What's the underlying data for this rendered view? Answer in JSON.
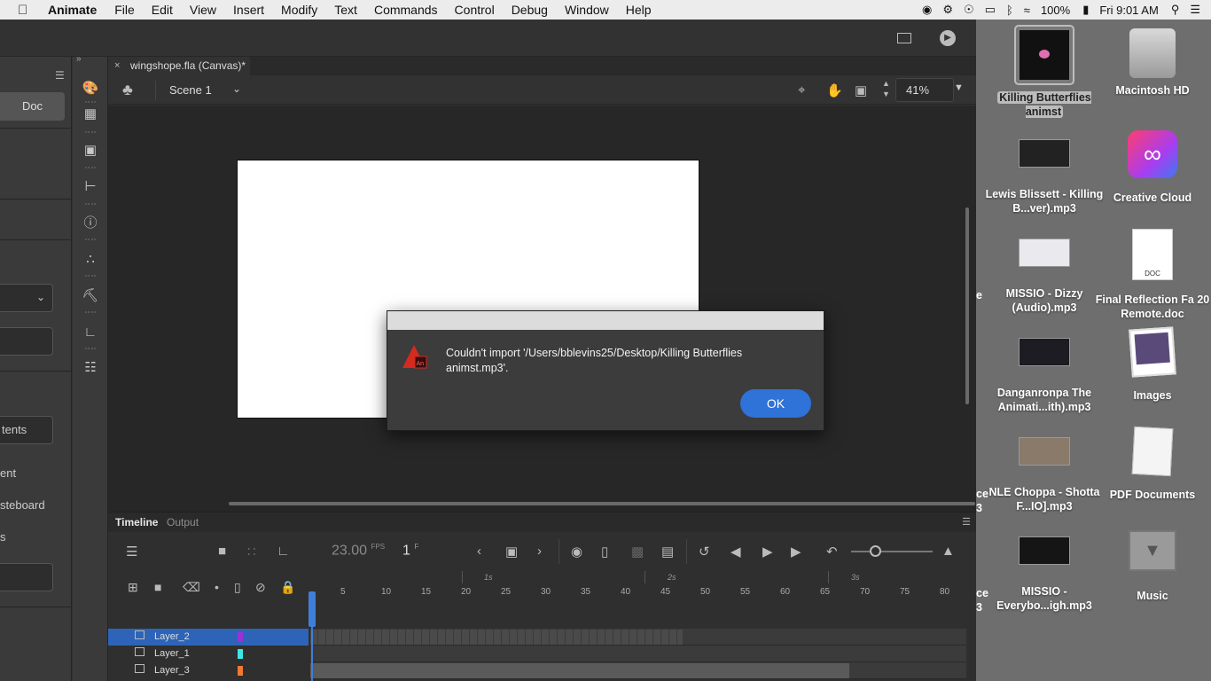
{
  "menubar": {
    "apple": "",
    "app_name": "Animate",
    "items": [
      "File",
      "Edit",
      "View",
      "Insert",
      "Modify",
      "Text",
      "Commands",
      "Control",
      "Debug",
      "Window",
      "Help"
    ],
    "battery": "100%",
    "clock": "Fri 9:01 AM"
  },
  "document": {
    "tab_title": "wingshope.fla (Canvas)*",
    "tab_close": "×",
    "scene": "Scene 1",
    "zoom": "41%"
  },
  "left_panel": {
    "doc_button": "Doc",
    "item_contents": "tents",
    "item_a": "ent",
    "item_b": "steboard",
    "item_c": "s"
  },
  "timeline": {
    "tab_timeline": "Timeline",
    "tab_output": "Output",
    "fps": "23.00",
    "fps_unit": "FPS",
    "frame": "1",
    "frame_unit": "F",
    "ruler_numbers": [
      "5",
      "10",
      "15",
      "20",
      "25",
      "30",
      "35",
      "40",
      "45",
      "50",
      "55",
      "60",
      "65",
      "70",
      "75",
      "80"
    ],
    "second_marks": [
      "1s",
      "2s",
      "3s"
    ],
    "layers": [
      {
        "name": "Layer_2",
        "color": "#9b30d9",
        "selected": true
      },
      {
        "name": "Layer_1",
        "color": "#3ee6e6",
        "selected": false
      },
      {
        "name": "Layer_3",
        "color": "#f07a30",
        "selected": false
      }
    ]
  },
  "dialog": {
    "message": "Couldn't import '/Users/bblevins25/Desktop/Killing Butterflies animst.mp3'.",
    "ok_label": "OK"
  },
  "desktop": {
    "icons": [
      {
        "label": "Killing Butterflies animst"
      },
      {
        "label": "Macintosh HD"
      },
      {
        "label": "Lewis Blissett - Killing B...ver).mp3"
      },
      {
        "label": "Creative Cloud"
      },
      {
        "label": "MISSIO - Dizzy (Audio).mp3"
      },
      {
        "label": "Final Reflection Fa 20 Remote.doc"
      },
      {
        "label": "Danganronpa The Animati...ith).mp3"
      },
      {
        "label": "Images"
      },
      {
        "label": "NLE Choppa - Shotta F...IO].mp3"
      },
      {
        "label": "PDF Documents"
      },
      {
        "label": "MISSIO - Everybo...igh.mp3"
      },
      {
        "label": "Music"
      }
    ],
    "partial_left": [
      "e",
      "ce",
      "3",
      "ce",
      "3"
    ],
    "doc_badge": "DOC"
  },
  "colors": {
    "accent_blue": "#2f72d8",
    "selection_blue": "#2d64b8"
  }
}
